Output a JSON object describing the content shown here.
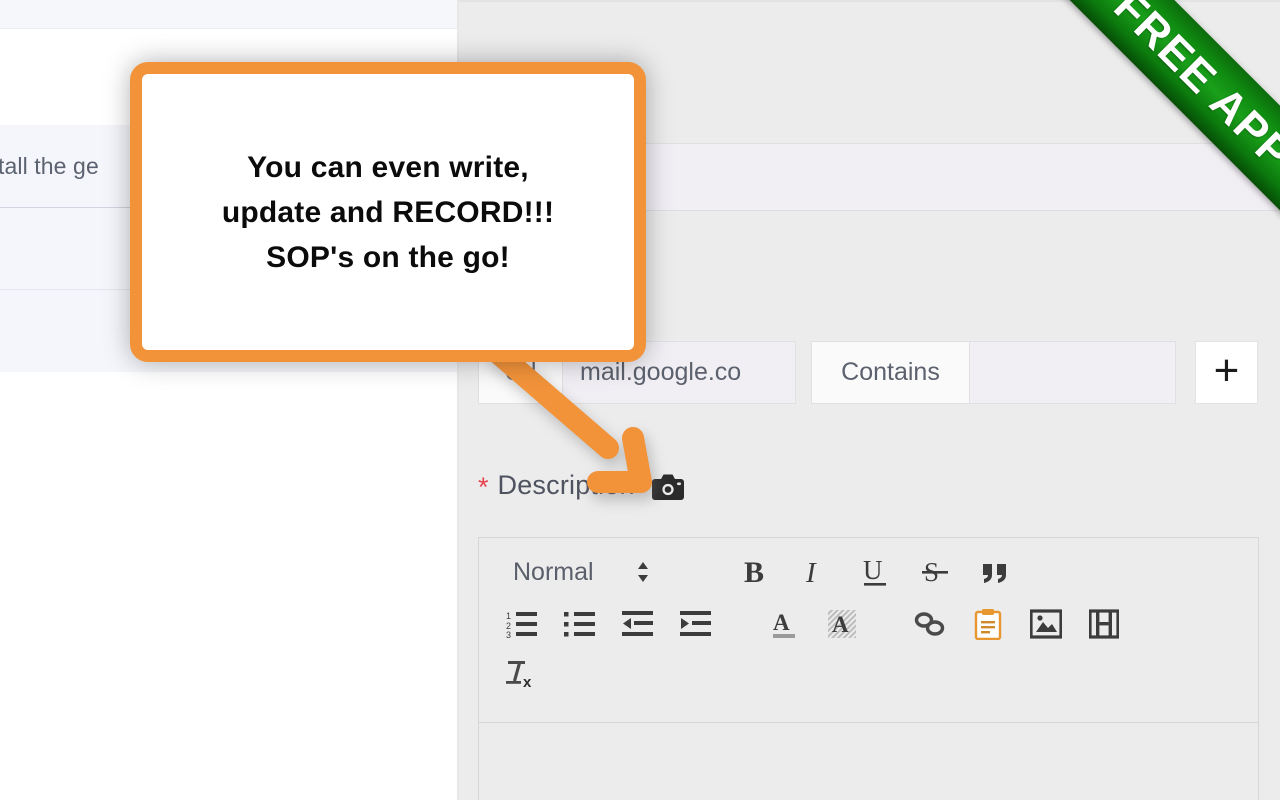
{
  "background_page": {
    "visible_text_fragment": "tall the ge"
  },
  "promo": {
    "ribbon_label": "FREE APP",
    "ribbon_color": "#0f8a10",
    "callout_text": "You can even write,\nupdate and RECORD!!!\nSOP's on the go!",
    "callout_border_color": "#f2933a",
    "arrow_color": "#f2933a"
  },
  "form": {
    "condition_row": {
      "field_type_label": "Url",
      "field_value": "mail.google.co",
      "operator_label": "Contains",
      "operator_value": "",
      "add_button_label": "+"
    },
    "description": {
      "required_marker": "*",
      "label": "Description",
      "camera_icon": "camera-icon"
    }
  },
  "editor": {
    "format_picker": {
      "value": "Normal",
      "icon": "chevron-updown-icon"
    },
    "toolbar_rows": [
      [
        {
          "name": "bold-icon",
          "label": "B"
        },
        {
          "name": "italic-icon",
          "label": "I"
        },
        {
          "name": "underline-icon",
          "label": "U"
        },
        {
          "name": "strikethrough-icon",
          "label": "S"
        },
        {
          "name": "blockquote-icon",
          "label": "”"
        }
      ],
      [
        {
          "name": "ordered-list-icon",
          "label": "Ordered list"
        },
        {
          "name": "bullet-list-icon",
          "label": "Bullet list"
        },
        {
          "name": "outdent-icon",
          "label": "Outdent"
        },
        {
          "name": "indent-icon",
          "label": "Indent"
        },
        {
          "name": "text-color-icon",
          "label": "Text color"
        },
        {
          "name": "background-color-icon",
          "label": "Background color"
        },
        {
          "name": "link-icon",
          "label": "Link"
        },
        {
          "name": "paste-clipboard-icon",
          "label": "Paste"
        },
        {
          "name": "image-icon",
          "label": "Image"
        },
        {
          "name": "video-icon",
          "label": "Video"
        }
      ],
      [
        {
          "name": "clear-formatting-icon",
          "label": "Clear formatting"
        }
      ]
    ],
    "content": ""
  },
  "colors": {
    "panel_background": "#ececec",
    "field_background": "#fafafb",
    "input_background": "#f1eff4",
    "required_star": "#e8434f",
    "left_panel_row": "#f4f6fb"
  }
}
